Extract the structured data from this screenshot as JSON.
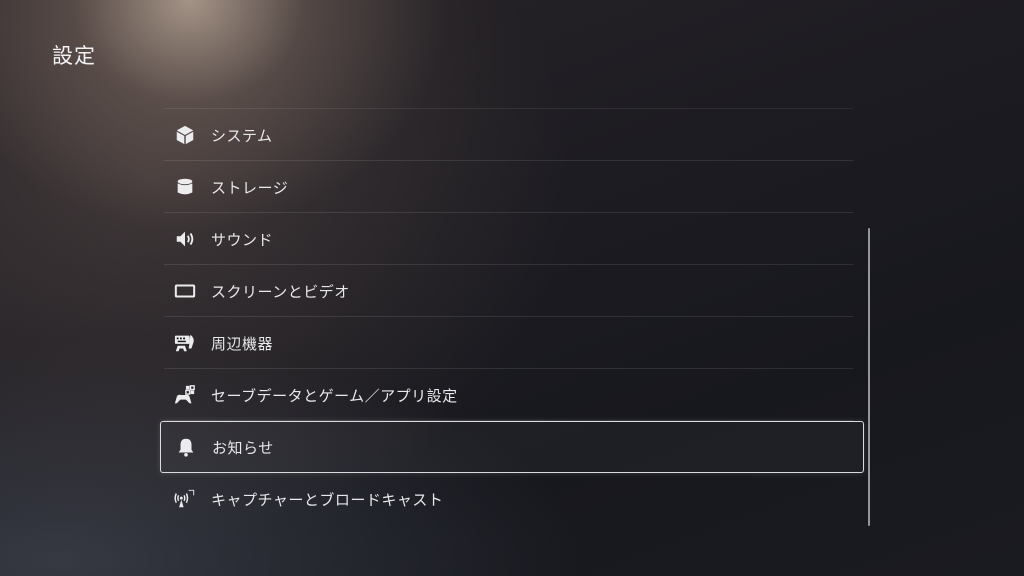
{
  "header": {
    "title": "設定"
  },
  "menu": {
    "items": [
      {
        "label": "システム",
        "icon": "system-cube-icon"
      },
      {
        "label": "ストレージ",
        "icon": "storage-cylinder-icon"
      },
      {
        "label": "サウンド",
        "icon": "speaker-icon"
      },
      {
        "label": "スクリーンとビデオ",
        "icon": "screen-icon"
      },
      {
        "label": "周辺機器",
        "icon": "peripherals-icon"
      },
      {
        "label": "セーブデータとゲーム／アプリ設定",
        "icon": "controller-apps-icon"
      },
      {
        "label": "お知らせ",
        "icon": "bell-icon",
        "focused": true
      },
      {
        "label": "キャプチャーとブロードキャスト",
        "icon": "broadcast-icon"
      }
    ]
  }
}
